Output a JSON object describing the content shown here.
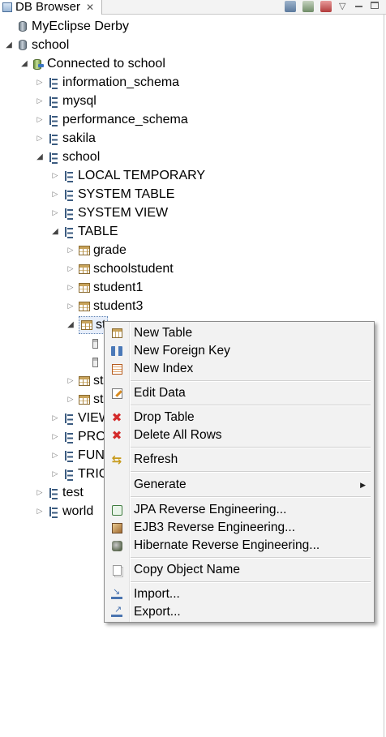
{
  "view": {
    "title": "DB Browser",
    "close_glyph": "✕"
  },
  "tree": {
    "profile": "MyEclipse Derby",
    "connection_profile": "school",
    "connected_label": "Connected to school",
    "schemas": {
      "information_schema": "information_schema",
      "mysql": "mysql",
      "performance_schema": "performance_schema",
      "sakila": "sakila",
      "school": "school",
      "test": "test",
      "world": "world"
    },
    "school_nodes": {
      "local_temporary": "LOCAL TEMPORARY",
      "system_table": "SYSTEM TABLE",
      "system_view": "SYSTEM VIEW",
      "table": "TABLE",
      "view": "VIEW",
      "procedure": "PRO",
      "function": "FUN",
      "trigger": "TRIG"
    },
    "tables": {
      "grade": "grade",
      "schoolstudent": "schoolstudent",
      "student1": "student1",
      "student3": "student3",
      "selected": "st",
      "after1": "st",
      "after2": "st"
    }
  },
  "context_menu": {
    "new_table": "New Table",
    "new_foreign_key": "New Foreign Key",
    "new_index": "New Index",
    "edit_data": "Edit Data",
    "drop_table": "Drop Table",
    "delete_all_rows": "Delete All Rows",
    "refresh": "Refresh",
    "generate": "Generate",
    "jpa_reverse": "JPA Reverse Engineering...",
    "ejb3_reverse": "EJB3 Reverse Engineering...",
    "hibernate_reverse": "Hibernate Reverse Engineering...",
    "copy_object_name": "Copy Object Name",
    "import": "Import...",
    "export": "Export..."
  }
}
